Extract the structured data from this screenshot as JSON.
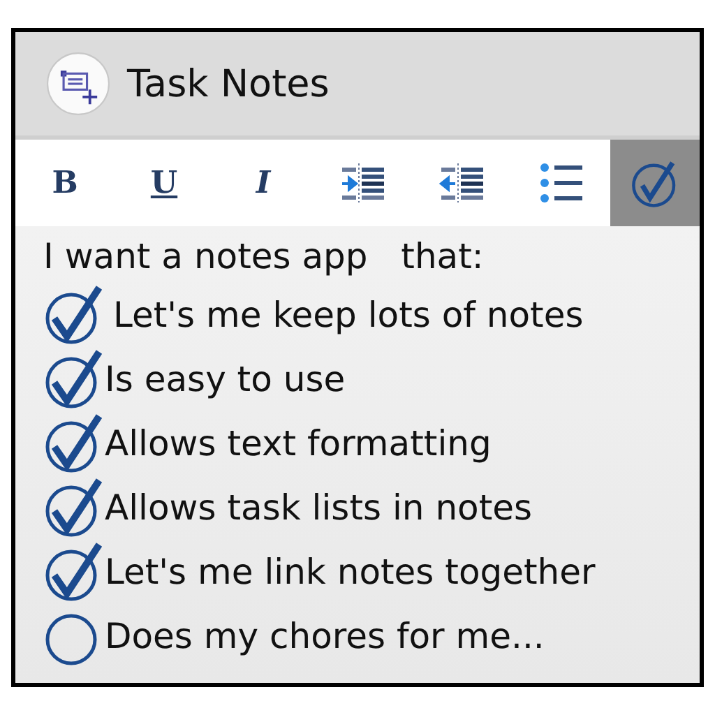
{
  "app_bar": {
    "title": "Task Notes"
  },
  "toolbar": [
    {
      "kind": "bold",
      "label": "B",
      "selected": false
    },
    {
      "kind": "underline",
      "label": "U",
      "selected": false
    },
    {
      "kind": "italic",
      "label": "I",
      "selected": false
    },
    {
      "kind": "indent",
      "selected": false
    },
    {
      "kind": "outdent",
      "selected": false
    },
    {
      "kind": "bullets",
      "selected": false
    },
    {
      "kind": "checklist",
      "selected": true
    }
  ],
  "note": {
    "heading": "I want a notes app   that:",
    "tasks": [
      {
        "text": "Let's me keep lots of notes",
        "checked": true
      },
      {
        "text": "Is easy to use",
        "checked": true
      },
      {
        "text": "Allows text formatting",
        "checked": true
      },
      {
        "text": "Allows task lists in notes",
        "checked": true
      },
      {
        "text": "Let's me link notes together",
        "checked": true
      },
      {
        "text": "Does my chores for me...",
        "checked": false
      }
    ]
  }
}
